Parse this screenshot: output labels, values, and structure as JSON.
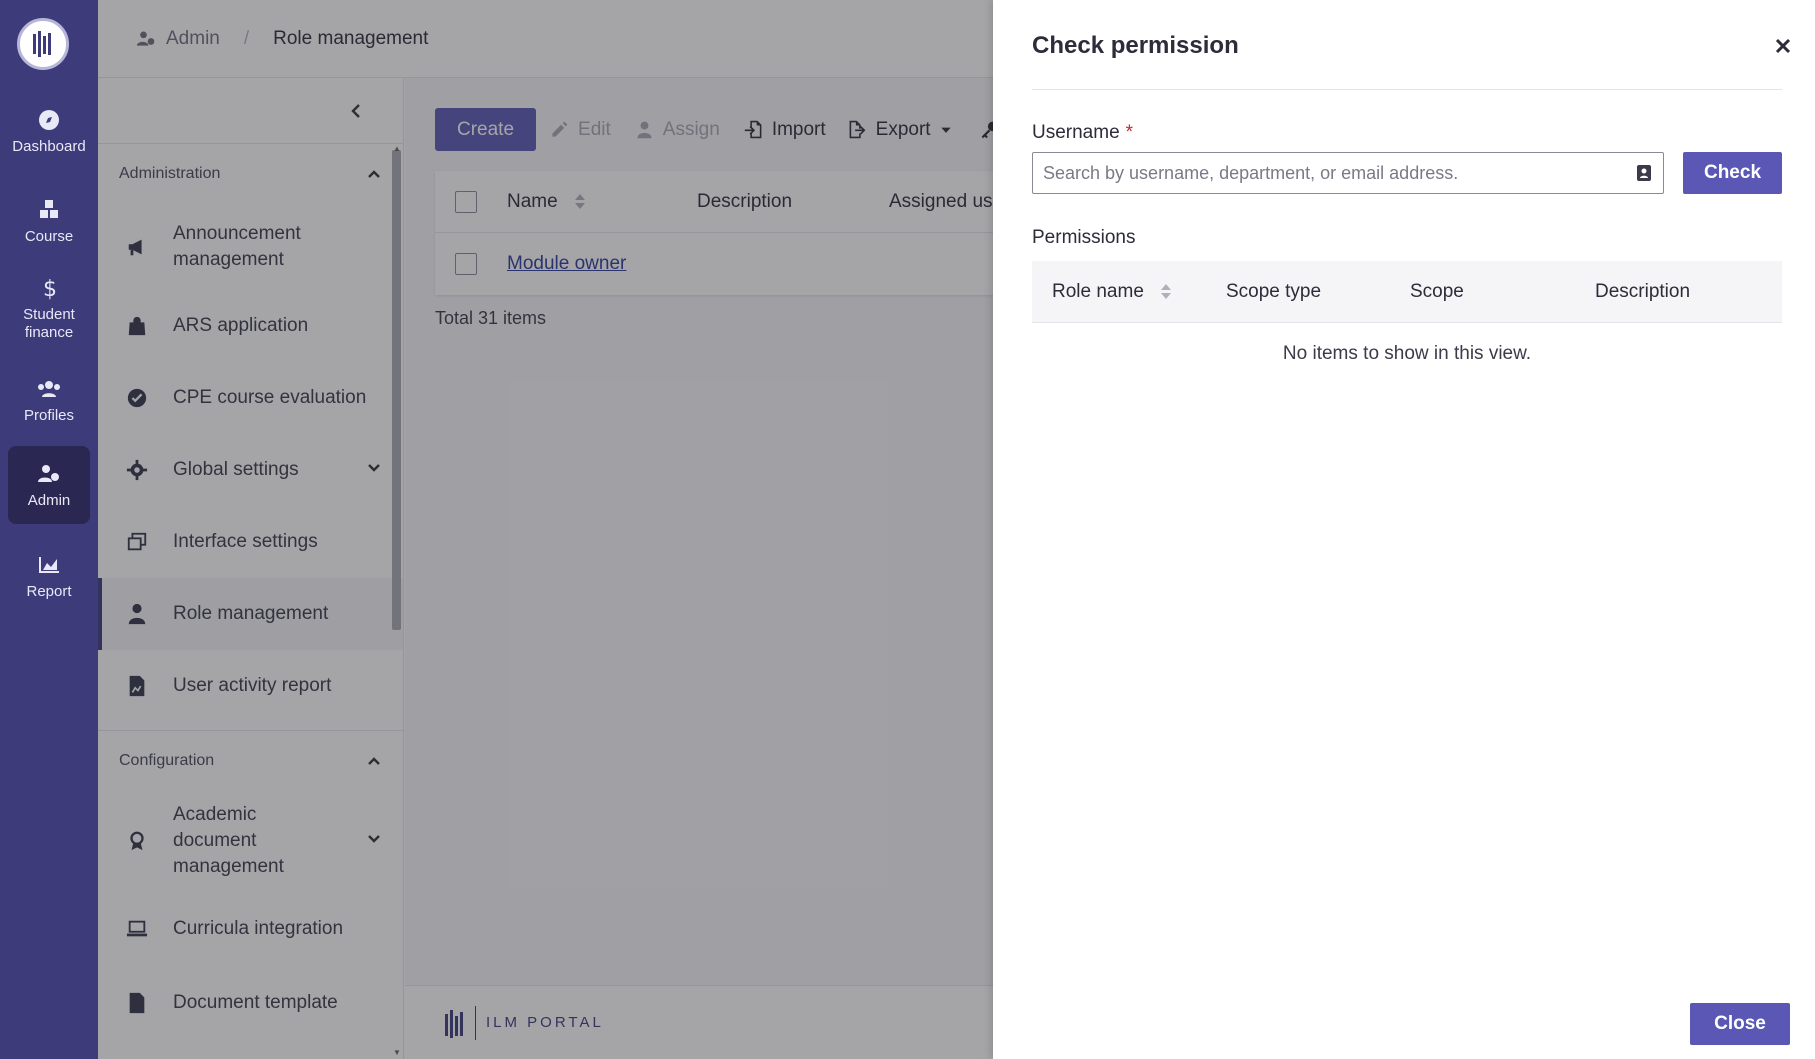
{
  "rail": {
    "items": [
      {
        "label": "Dashboard",
        "icon": "compass-icon"
      },
      {
        "label": "Course",
        "icon": "cubes-icon"
      },
      {
        "label": "Student finance",
        "icon": "dollar-icon"
      },
      {
        "label": "Profiles",
        "icon": "users-icon"
      },
      {
        "label": "Admin",
        "icon": "user-gear-icon",
        "active": true
      },
      {
        "label": "Report",
        "icon": "area-chart-icon"
      }
    ]
  },
  "header": {
    "crumb_parent": "Admin",
    "crumb_separator": "/",
    "crumb_current": "Role management"
  },
  "sidebar": {
    "groups": [
      {
        "title": "Administration",
        "items": [
          {
            "label": "Announcement management",
            "icon": "megaphone-icon"
          },
          {
            "label": "ARS application",
            "icon": "bag-icon"
          },
          {
            "label": "CPE course evaluation",
            "icon": "check-circle-icon"
          },
          {
            "label": "Global settings",
            "icon": "gear-icon",
            "expandable": true
          },
          {
            "label": "Interface settings",
            "icon": "windows-icon"
          },
          {
            "label": "Role management",
            "icon": "user-tie-icon",
            "active": true
          },
          {
            "label": "User activity report",
            "icon": "file-chart-icon"
          }
        ]
      },
      {
        "title": "Configuration",
        "items": [
          {
            "label": "Academic document management",
            "icon": "award-icon",
            "expandable": true
          },
          {
            "label": "Curricula integration",
            "icon": "laptop-icon"
          },
          {
            "label": "Document template",
            "icon": "file-icon"
          }
        ]
      }
    ]
  },
  "toolbar": {
    "create": "Create",
    "edit": "Edit",
    "assign": "Assign",
    "import": "Import",
    "export": "Export"
  },
  "table": {
    "columns": [
      "Name",
      "Description",
      "Assigned us"
    ],
    "rows": [
      {
        "name": "Module owner"
      }
    ],
    "total": "Total 31 items"
  },
  "footer": {
    "brand": "ILM PORTAL"
  },
  "drawer": {
    "title": "Check permission",
    "username_label": "Username",
    "required_mark": "*",
    "search_placeholder": "Search by username, department, or email address.",
    "check_button": "Check",
    "permissions_label": "Permissions",
    "columns": [
      "Role name",
      "Scope type",
      "Scope",
      "Description"
    ],
    "empty_text": "No items to show in this view.",
    "close_button": "Close"
  },
  "colors": {
    "rail": "#3d3b7a",
    "accent": "#5a58b4",
    "link": "#2d3c9c"
  }
}
